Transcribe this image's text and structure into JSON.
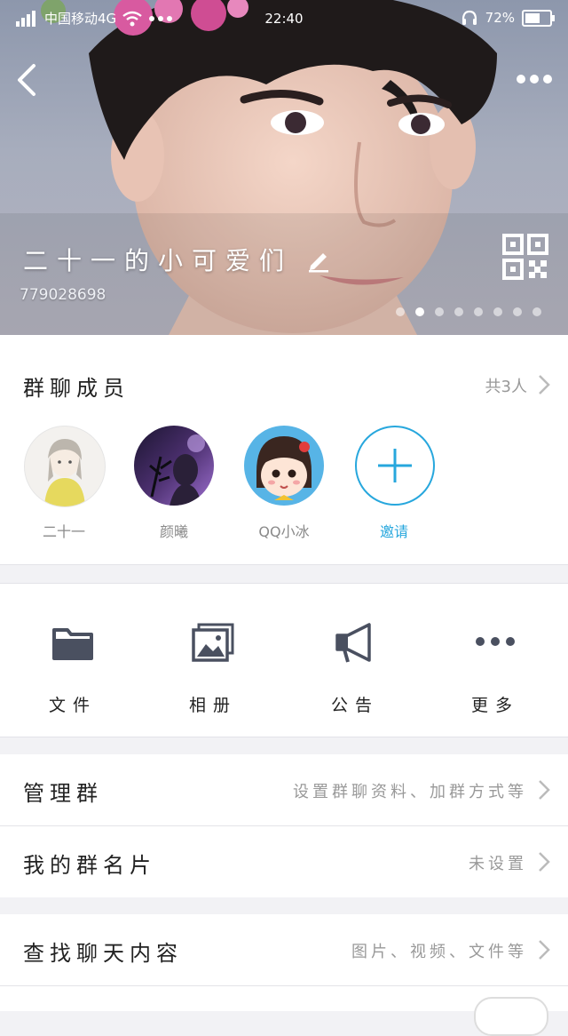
{
  "status_bar": {
    "carrier": "中国移动4G",
    "time": "22:40",
    "battery": "72%",
    "battery_level": 0.72
  },
  "header": {
    "group_name": "二十一的小可爱们",
    "group_id": "779028698",
    "page_dots": 8,
    "active_dot": 1
  },
  "members": {
    "title": "群聊成员",
    "count": "共3人",
    "items": [
      {
        "name": "二十一"
      },
      {
        "name": "颜曦"
      },
      {
        "name": "QQ小冰"
      }
    ],
    "invite_label": "邀请"
  },
  "actions": [
    {
      "label": "文件",
      "icon": "folder-icon"
    },
    {
      "label": "相册",
      "icon": "photo-album-icon"
    },
    {
      "label": "公告",
      "icon": "megaphone-icon"
    },
    {
      "label": "更多",
      "icon": "more-icon"
    }
  ],
  "rows": {
    "manage": {
      "title": "管理群",
      "value": "设置群聊资料、加群方式等"
    },
    "card": {
      "title": "我的群名片",
      "value": "未设置"
    },
    "search": {
      "title": "查找聊天内容",
      "value": "图片、视频、文件等"
    }
  },
  "colors": {
    "accent": "#27a7dd",
    "muted_text": "#999999",
    "icon_gray": "#4a5060"
  }
}
